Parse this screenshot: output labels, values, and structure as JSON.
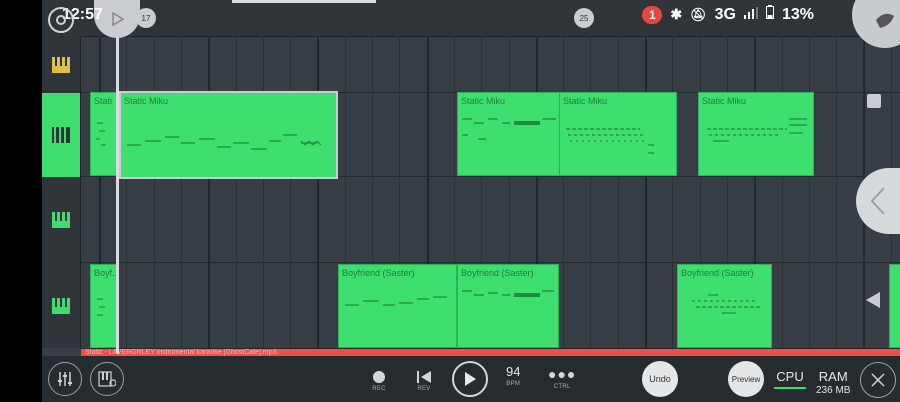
{
  "status_bar": {
    "time": "12:57",
    "notification_count": "1",
    "network": "3G",
    "battery": "13%"
  },
  "ruler": {
    "markers": [
      "17",
      "25"
    ]
  },
  "tracks": [
    {
      "id": "track-1",
      "icon": "keyboard-icon"
    },
    {
      "id": "track-2",
      "icon": "keyboard-icon"
    },
    {
      "id": "track-3",
      "icon": "keyboard-icon"
    },
    {
      "id": "track-4",
      "icon": "keyboard-icon"
    }
  ],
  "clips": {
    "static_1": "Stati",
    "static_2": "Static Miku",
    "static_3": "Static Miku",
    "static_4": "Static Miku",
    "static_5": "Static Miku",
    "bf_1": "Boyf...",
    "bf_2": "Boyfriend (Saster)",
    "bf_3": "Boyfriend (Saster)",
    "bf_4": "Boyfriend (Saster)"
  },
  "audio_strip": {
    "text": "Static - LAVERGRLEY instrumental karaoke [GhostCafe].mp3"
  },
  "toolbar": {
    "rec_label": "REC",
    "rev_label": "REV",
    "bpm_value": "94",
    "bpm_label": "BPM",
    "ctrl_label": "CTRL",
    "undo_label": "Undo",
    "preview_label": "Preview",
    "cpu_label": "CPU",
    "ram_label": "RAM",
    "ram_value": "236 MB"
  },
  "colors": {
    "clip_green": "#3ede6f",
    "audio_red": "#e8524a",
    "background": "#363d44"
  }
}
